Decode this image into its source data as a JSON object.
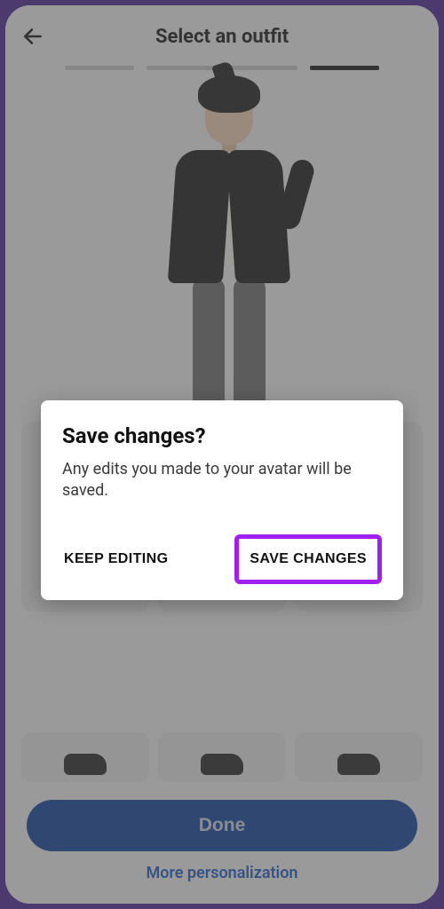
{
  "header": {
    "title": "Select an outfit"
  },
  "progress": {
    "total": 4,
    "active_index": 3
  },
  "dialog": {
    "title": "Save changes?",
    "body": "Any edits you made to your avatar will be saved.",
    "keep_editing_label": "KEEP EDITING",
    "save_changes_label": "SAVE CHANGES"
  },
  "footer": {
    "done_label": "Done",
    "more_label": "More personalization"
  },
  "highlight": {
    "color": "#a020ef"
  }
}
